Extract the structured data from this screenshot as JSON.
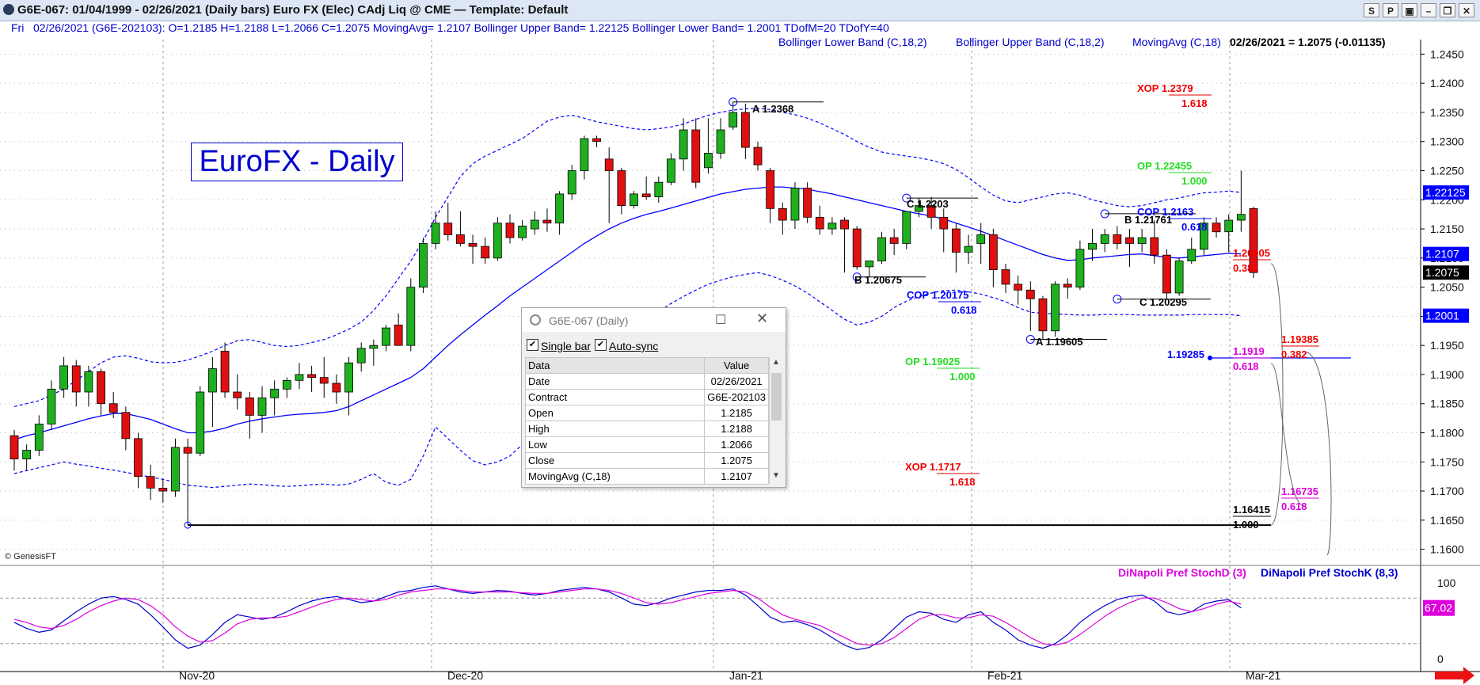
{
  "window": {
    "title": "G6E-067:  01/04/1999 - 02/26/2021  (Daily bars)   Euro FX (Elec) CAdj Liq @ CME  —  Template: Default",
    "buttons": [
      "S",
      "P",
      "▣",
      "–",
      "❐",
      "✕"
    ]
  },
  "infobar": {
    "day": "Fri",
    "ohlc": "02/26/2021 (G6E-202103):  O=1.2185  H=1.2188  L=1.2066  C=1.2075  MovingAvg= 1.2107  Bollinger Upper Band= 1.22125  Bollinger Lower Band= 1.2001  TDofM=20  TDofY=40"
  },
  "legend_top": {
    "lower": "Bollinger Lower Band (C,18,2)",
    "upper": "Bollinger Upper Band (C,18,2)",
    "ma": "MovingAvg (C,18)",
    "last": "02/26/2021 = 1.2075 (-0.01135)"
  },
  "chart_title": "EuroFX - Daily",
  "copyright": "© GenesisFT",
  "colors": {
    "up": "#1fb01f",
    "down": "#e01010",
    "band": "#0000ff",
    "ma": "#0000ff",
    "stochK": "#0000cc",
    "stochD": "#dd00dd"
  },
  "chart_data": {
    "type": "candlestick",
    "x_labels": [
      "Nov-20",
      "Dec-20",
      "Jan-21",
      "Feb-21",
      "Mar-21"
    ],
    "y_ticks": [
      "1.2450",
      "1.2400",
      "1.2350",
      "1.2300",
      "1.2250",
      "1.2200",
      "1.2150",
      "1.2100",
      "1.2050",
      "1.2000",
      "1.1950",
      "1.1900",
      "1.1850",
      "1.1800",
      "1.1750",
      "1.1700",
      "1.1650",
      "1.1600"
    ],
    "ylim": [
      1.1575,
      1.2475
    ],
    "bars": [
      [
        1.1795,
        1.1805,
        1.1735,
        1.1755
      ],
      [
        1.1755,
        1.178,
        1.1735,
        1.177
      ],
      [
        1.177,
        1.183,
        1.176,
        1.1815
      ],
      [
        1.1815,
        1.189,
        1.1805,
        1.1875
      ],
      [
        1.1875,
        1.193,
        1.186,
        1.1915
      ],
      [
        1.1915,
        1.1925,
        1.1845,
        1.187
      ],
      [
        1.187,
        1.1915,
        1.1845,
        1.1905
      ],
      [
        1.1905,
        1.191,
        1.183,
        1.185
      ],
      [
        1.185,
        1.187,
        1.1825,
        1.1835
      ],
      [
        1.1835,
        1.1845,
        1.177,
        1.179
      ],
      [
        1.179,
        1.18,
        1.1705,
        1.1725
      ],
      [
        1.1725,
        1.1745,
        1.1685,
        1.1705
      ],
      [
        1.1705,
        1.172,
        1.168,
        1.17
      ],
      [
        1.17,
        1.179,
        1.169,
        1.1775
      ],
      [
        1.1775,
        1.179,
        1.16415,
        1.1765
      ],
      [
        1.1765,
        1.188,
        1.176,
        1.187
      ],
      [
        1.187,
        1.193,
        1.181,
        1.191
      ],
      [
        1.194,
        1.1955,
        1.186,
        1.187
      ],
      [
        1.187,
        1.19,
        1.184,
        1.186
      ],
      [
        1.186,
        1.187,
        1.179,
        1.183
      ],
      [
        1.183,
        1.188,
        1.18,
        1.186
      ],
      [
        1.186,
        1.189,
        1.183,
        1.1875
      ],
      [
        1.1875,
        1.1895,
        1.186,
        1.189
      ],
      [
        1.189,
        1.192,
        1.1875,
        1.19
      ],
      [
        1.19,
        1.1915,
        1.187,
        1.1895
      ],
      [
        1.1895,
        1.193,
        1.186,
        1.1885
      ],
      [
        1.1885,
        1.19,
        1.185,
        1.187
      ],
      [
        1.187,
        1.193,
        1.183,
        1.192
      ],
      [
        1.192,
        1.1955,
        1.1905,
        1.1945
      ],
      [
        1.1945,
        1.196,
        1.1915,
        1.195
      ],
      [
        1.195,
        1.1985,
        1.194,
        1.198
      ],
      [
        1.1985,
        1.2005,
        1.196,
        1.195
      ],
      [
        1.195,
        1.2065,
        1.194,
        1.205
      ],
      [
        1.205,
        1.2135,
        1.204,
        1.2125
      ],
      [
        1.2125,
        1.218,
        1.2115,
        1.216
      ],
      [
        1.216,
        1.2195,
        1.213,
        1.214
      ],
      [
        1.214,
        1.218,
        1.212,
        1.2125
      ],
      [
        1.2125,
        1.214,
        1.209,
        1.212
      ],
      [
        1.212,
        1.2135,
        1.209,
        1.21
      ],
      [
        1.21,
        1.217,
        1.2095,
        1.216
      ],
      [
        1.216,
        1.2175,
        1.2125,
        1.2135
      ],
      [
        1.2135,
        1.2165,
        1.213,
        1.2155
      ],
      [
        1.215,
        1.218,
        1.214,
        1.2165
      ],
      [
        1.2165,
        1.2185,
        1.2145,
        1.216
      ],
      [
        1.216,
        1.2215,
        1.214,
        1.221
      ],
      [
        1.221,
        1.226,
        1.22,
        1.225
      ],
      [
        1.225,
        1.231,
        1.2235,
        1.2305
      ],
      [
        1.2305,
        1.231,
        1.229,
        1.23
      ],
      [
        1.227,
        1.229,
        1.216,
        1.225
      ],
      [
        1.225,
        1.2255,
        1.2175,
        1.219
      ],
      [
        1.219,
        1.2215,
        1.2185,
        1.221
      ],
      [
        1.221,
        1.224,
        1.22,
        1.2205
      ],
      [
        1.2205,
        1.224,
        1.2195,
        1.223
      ],
      [
        1.223,
        1.228,
        1.2225,
        1.227
      ],
      [
        1.227,
        1.234,
        1.225,
        1.232
      ],
      [
        1.232,
        1.234,
        1.222,
        1.223
      ],
      [
        1.2255,
        1.234,
        1.2245,
        1.228
      ],
      [
        1.228,
        1.234,
        1.227,
        1.232
      ],
      [
        1.2325,
        1.2368,
        1.232,
        1.235
      ],
      [
        1.235,
        1.2365,
        1.227,
        1.229
      ],
      [
        1.229,
        1.23,
        1.225,
        1.226
      ],
      [
        1.225,
        1.2255,
        1.216,
        1.2185
      ],
      [
        1.2185,
        1.2195,
        1.214,
        1.2165
      ],
      [
        1.2165,
        1.223,
        1.215,
        1.222
      ],
      [
        1.222,
        1.223,
        1.216,
        1.217
      ],
      [
        1.217,
        1.219,
        1.214,
        1.215
      ],
      [
        1.215,
        1.217,
        1.214,
        1.216
      ],
      [
        1.2165,
        1.217,
        1.2075,
        1.215
      ],
      [
        1.215,
        1.2155,
        1.208,
        1.2085
      ],
      [
        1.2085,
        1.2095,
        1.2068,
        1.2095
      ],
      [
        1.2095,
        1.2145,
        1.209,
        1.2135
      ],
      [
        1.2135,
        1.215,
        1.2105,
        1.2125
      ],
      [
        1.2125,
        1.218,
        1.2115,
        1.218
      ],
      [
        1.218,
        1.2203,
        1.217,
        1.219
      ],
      [
        1.219,
        1.2205,
        1.215,
        1.217
      ],
      [
        1.217,
        1.2185,
        1.211,
        1.215
      ],
      [
        1.215,
        1.216,
        1.2075,
        1.211
      ],
      [
        1.211,
        1.214,
        1.209,
        1.212
      ],
      [
        1.2125,
        1.216,
        1.209,
        1.214
      ],
      [
        1.214,
        1.215,
        1.205,
        1.208
      ],
      [
        1.208,
        1.209,
        1.204,
        1.2055
      ],
      [
        1.2055,
        1.207,
        1.202,
        1.2045
      ],
      [
        1.2045,
        1.206,
        1.1975,
        1.203
      ],
      [
        1.203,
        1.2035,
        1.196,
        1.1975
      ],
      [
        1.1975,
        1.206,
        1.1965,
        1.2055
      ],
      [
        1.2055,
        1.2065,
        1.203,
        1.205
      ],
      [
        1.205,
        1.213,
        1.2045,
        1.2115
      ],
      [
        1.2115,
        1.215,
        1.2095,
        1.2125
      ],
      [
        1.2125,
        1.215,
        1.211,
        1.214
      ],
      [
        1.214,
        1.2155,
        1.2115,
        1.2125
      ],
      [
        1.2135,
        1.215,
        1.2085,
        1.2125
      ],
      [
        1.2125,
        1.215,
        1.211,
        1.2135
      ],
      [
        1.2135,
        1.2165,
        1.209,
        1.2105
      ],
      [
        1.2105,
        1.2115,
        1.2029,
        1.204
      ],
      [
        1.204,
        1.21,
        1.2035,
        1.2095
      ],
      [
        1.2095,
        1.2135,
        1.209,
        1.2115
      ],
      [
        1.2115,
        1.217,
        1.2105,
        1.216
      ],
      [
        1.216,
        1.217,
        1.2135,
        1.2145
      ],
      [
        1.2145,
        1.2175,
        1.211,
        1.2165
      ],
      [
        1.2165,
        1.225,
        1.2145,
        1.2175
      ],
      [
        1.2185,
        1.2188,
        1.2066,
        1.2075
      ]
    ],
    "moving_avg": [
      1.1788,
      1.1795,
      1.18,
      1.1806,
      1.1812,
      1.1818,
      1.1824,
      1.1829,
      1.1833,
      1.1833,
      1.1828,
      1.1823,
      1.1815,
      1.1807,
      1.18,
      1.18,
      1.1803,
      1.1808,
      1.1815,
      1.182,
      1.1824,
      1.1827,
      1.183,
      1.1832,
      1.1833,
      1.1835,
      1.1838,
      1.1845,
      1.1855,
      1.1865,
      1.1875,
      1.1885,
      1.1895,
      1.191,
      1.193,
      1.195,
      1.1968,
      1.1985,
      1.2002,
      1.2018,
      1.2035,
      1.205,
      1.2065,
      1.208,
      1.2095,
      1.211,
      1.2125,
      1.2138,
      1.215,
      1.216,
      1.2168,
      1.2175,
      1.218,
      1.2186,
      1.2192,
      1.2198,
      1.2204,
      1.221,
      1.2214,
      1.2218,
      1.222,
      1.2222,
      1.2222,
      1.222,
      1.2218,
      1.2214,
      1.221,
      1.2205,
      1.22,
      1.2195,
      1.219,
      1.2185,
      1.218,
      1.2176,
      1.2172,
      1.2167,
      1.216,
      1.2153,
      1.2146,
      1.2138,
      1.213,
      1.2122,
      1.2114,
      1.2106,
      1.21,
      1.2096,
      1.2097,
      1.21,
      1.2102,
      1.2104,
      1.2106,
      1.2107,
      1.2104,
      1.2101,
      1.21,
      1.2102,
      1.2104,
      1.2106,
      1.2108,
      1.2107
    ],
    "upper_band": [
      1.1845,
      1.185,
      1.1855,
      1.1865,
      1.1875,
      1.189,
      1.1905,
      1.192,
      1.193,
      1.1932,
      1.1928,
      1.1922,
      1.192,
      1.1921,
      1.1925,
      1.1932,
      1.194,
      1.195,
      1.1958,
      1.196,
      1.1955,
      1.195,
      1.1948,
      1.195,
      1.1955,
      1.196,
      1.1968,
      1.1978,
      1.199,
      1.201,
      1.2035,
      1.2065,
      1.2095,
      1.213,
      1.217,
      1.2205,
      1.224,
      1.2262,
      1.2275,
      1.2285,
      1.2295,
      1.2305,
      1.232,
      1.2335,
      1.2342,
      1.2345,
      1.234,
      1.2334,
      1.233,
      1.2326,
      1.2322,
      1.232,
      1.2322,
      1.2325,
      1.233,
      1.2338,
      1.2345,
      1.235,
      1.2354,
      1.2356,
      1.2357,
      1.2355,
      1.235,
      1.2346,
      1.234,
      1.2332,
      1.2322,
      1.2312,
      1.23,
      1.229,
      1.2282,
      1.2278,
      1.2275,
      1.2272,
      1.2268,
      1.2262,
      1.2252,
      1.2238,
      1.2222,
      1.2208,
      1.2198,
      1.2195,
      1.22,
      1.2205,
      1.221,
      1.2212,
      1.2208,
      1.22,
      1.2195,
      1.219,
      1.2188,
      1.219,
      1.2195,
      1.22,
      1.2203,
      1.2208,
      1.2212,
      1.2213,
      1.2215,
      1.22125
    ],
    "lower_band": [
      1.173,
      1.1735,
      1.174,
      1.1745,
      1.175,
      1.1746,
      1.1743,
      1.1739,
      1.1736,
      1.1732,
      1.1728,
      1.1724,
      1.172,
      1.1715,
      1.171,
      1.1708,
      1.1706,
      1.1708,
      1.171,
      1.1712,
      1.1711,
      1.1709,
      1.1708,
      1.1709,
      1.1711,
      1.1712,
      1.171,
      1.1712,
      1.172,
      1.173,
      1.1715,
      1.171,
      1.172,
      1.176,
      1.181,
      1.179,
      1.177,
      1.1752,
      1.1745,
      1.175,
      1.176,
      1.178,
      1.1795,
      1.1815,
      1.184,
      1.186,
      1.1885,
      1.191,
      1.1935,
      1.1955,
      1.1975,
      1.1992,
      1.2008,
      1.2022,
      1.2034,
      1.2045,
      1.2055,
      1.2062,
      1.2068,
      1.2072,
      1.2075,
      1.207,
      1.2062,
      1.2052,
      1.204,
      1.2025,
      1.201,
      1.1995,
      1.1985,
      1.199,
      1.2,
      1.2015,
      1.2026,
      1.2034,
      1.204,
      1.2044,
      1.2045,
      1.2042,
      1.2038,
      1.2032,
      1.2025,
      1.2015,
      1.2007,
      1.2005,
      1.2004,
      1.2003,
      1.2002,
      1.2002,
      1.2003,
      1.2003,
      1.2003,
      1.2002,
      1.2002,
      1.2002,
      1.2002,
      1.2003,
      1.2003,
      1.2003,
      1.2003,
      1.2001
    ],
    "right_axis_tags": [
      {
        "text": "1.22125",
        "value": 1.22125,
        "bg": "#0000ff"
      },
      {
        "text": "1.2107",
        "value": 1.2107,
        "bg": "#0000ff"
      },
      {
        "text": "1.2075",
        "value": 1.2075,
        "bg": "#000000"
      },
      {
        "text": "1.2001",
        "value": 1.2001,
        "bg": "#0000ff"
      }
    ],
    "swing_labels": [
      {
        "text": "A 1.2368",
        "bar": 58,
        "price": 1.2368,
        "color": "#000000"
      },
      {
        "text": "B 1.20675",
        "bar": 68,
        "price": 1.20675,
        "color": "#000000"
      },
      {
        "text": "C 1.2203",
        "bar": 72,
        "price": 1.2203,
        "color": "#000000"
      },
      {
        "text": "A 1.19605",
        "bar": 82,
        "price": 1.19605,
        "color": "#000000"
      },
      {
        "text": "B 1.21761",
        "bar": 88,
        "price": 1.2176,
        "color": "#000000"
      },
      {
        "text": "C 1.20295",
        "bar": 89,
        "price": 1.20295,
        "color": "#000000"
      }
    ],
    "fib_labels": [
      {
        "text": "XOP 1.2379",
        "sub": "1.618",
        "value": 1.2379,
        "color": "#ee0000"
      },
      {
        "text": "OP 1.22455",
        "sub": "1.000",
        "value": 1.22455,
        "color": "#22dd22"
      },
      {
        "text": "COP 1.2163",
        "sub": "0.618",
        "value": 1.2163,
        "color": "#0000ff"
      },
      {
        "text": "COP 1.20175",
        "sub": "0.618",
        "value": 1.20175,
        "color": "#0000ff"
      },
      {
        "text": "OP 1.19025",
        "sub": "1.000",
        "value": 1.19025,
        "color": "#22dd22"
      },
      {
        "text": "XOP 1.1717",
        "sub": "1.618",
        "value": 1.1717,
        "color": "#ee0000"
      },
      {
        "text": "1.20905",
        "sub": "0.382",
        "value": 1.20905,
        "color": "#ee0000"
      },
      {
        "text": "1.19385",
        "sub": "0.382",
        "value": 1.19385,
        "color": "#ee0000"
      },
      {
        "text": "1.1919",
        "sub": "0.618",
        "value": 1.1919,
        "color": "#dd00dd"
      },
      {
        "text": "1.16735",
        "sub": "0.618",
        "value": 1.16735,
        "color": "#dd00dd"
      },
      {
        "text": "1.16415",
        "sub": "1.000",
        "value": 1.16415,
        "color": "#000000"
      },
      {
        "text": "1.19285",
        "sub": "",
        "value": 1.19285,
        "color": "#0000ff"
      }
    ],
    "stoch_legend": [
      "DiNapoli Pref StochD (3)",
      "DiNapoli Pref StochK (8,3)"
    ],
    "stoch_ticks": [
      "100",
      "0"
    ],
    "stoch_tag": "67.02",
    "stochK": [
      48,
      40,
      35,
      38,
      50,
      62,
      72,
      80,
      82,
      78,
      72,
      58,
      42,
      25,
      14,
      18,
      32,
      48,
      58,
      55,
      52,
      55,
      62,
      70,
      76,
      80,
      82,
      78,
      74,
      76,
      82,
      88,
      90,
      94,
      96,
      92,
      88,
      86,
      88,
      90,
      89,
      86,
      84,
      86,
      90,
      92,
      94,
      92,
      88,
      80,
      72,
      70,
      74,
      80,
      84,
      88,
      90,
      90,
      92,
      84,
      70,
      55,
      48,
      50,
      45,
      38,
      28,
      18,
      12,
      15,
      25,
      40,
      55,
      62,
      60,
      52,
      48,
      58,
      62,
      48,
      38,
      25,
      18,
      14,
      20,
      32,
      48,
      60,
      70,
      78,
      82,
      84,
      76,
      62,
      58,
      62,
      72,
      76,
      78,
      67
    ],
    "stochD": [
      52,
      48,
      42,
      40,
      44,
      52,
      62,
      70,
      76,
      80,
      78,
      70,
      58,
      42,
      30,
      22,
      24,
      34,
      46,
      52,
      54,
      54,
      56,
      62,
      68,
      74,
      78,
      80,
      78,
      76,
      78,
      84,
      88,
      90,
      92,
      92,
      90,
      88,
      88,
      88,
      88,
      87,
      86,
      86,
      88,
      90,
      92,
      92,
      90,
      86,
      80,
      74,
      72,
      74,
      78,
      82,
      86,
      88,
      90,
      88,
      80,
      68,
      58,
      52,
      48,
      44,
      36,
      28,
      20,
      18,
      20,
      28,
      40,
      52,
      58,
      58,
      54,
      54,
      58,
      56,
      48,
      38,
      28,
      20,
      18,
      22,
      32,
      44,
      56,
      66,
      74,
      80,
      80,
      74,
      66,
      62,
      66,
      72,
      76,
      72
    ]
  },
  "data_window": {
    "title": "G6E-067 (Daily)",
    "single_bar": "Single bar",
    "auto_sync": "Auto-sync",
    "headers": [
      "Data",
      "Value"
    ],
    "rows": [
      [
        "Date",
        "02/26/2021"
      ],
      [
        "Contract",
        "G6E-202103"
      ],
      [
        "Open",
        "1.2185"
      ],
      [
        "High",
        "1.2188"
      ],
      [
        "Low",
        "1.2066"
      ],
      [
        "Close",
        "1.2075"
      ],
      [
        "MovingAvg (C,18)",
        "1.2107"
      ]
    ]
  }
}
